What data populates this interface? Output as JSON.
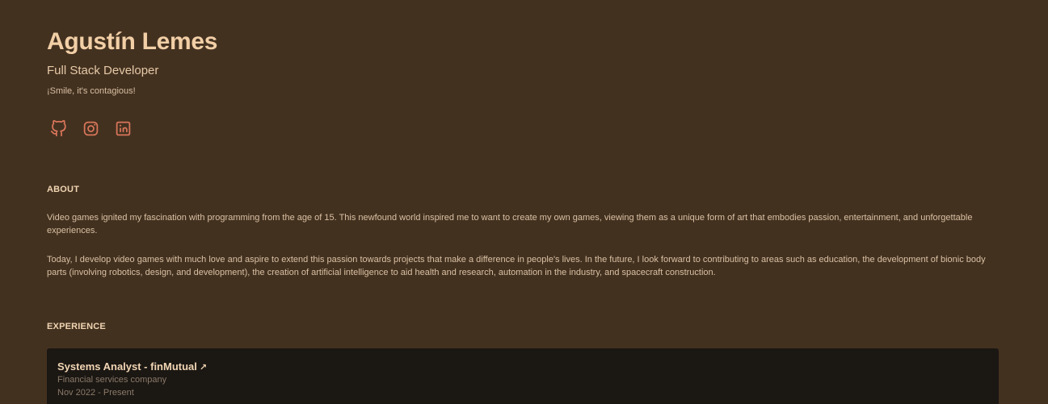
{
  "profile": {
    "name": "Agustín Lemes",
    "role": "Full Stack Developer",
    "tagline": "¡Smile, it's contagious!"
  },
  "socials": [
    {
      "icon": "github-icon"
    },
    {
      "icon": "instagram-icon"
    },
    {
      "icon": "linkedin-icon"
    }
  ],
  "colors": {
    "background": "#433120",
    "accent": "#d9765a",
    "card": "#1b1713"
  },
  "about": {
    "heading": "ABOUT",
    "paragraphs": [
      "Video games ignited my fascination with programming from the age of 15. This newfound world inspired me to want to create my own games, viewing them as a unique form of art that embodies passion, entertainment, and unforgettable experiences.",
      "Today, I develop video games with much love and aspire to extend this passion towards projects that make a difference in people's lives. In the future, I look forward to contributing to areas such as education, the development of bionic body parts (involving robotics, design, and development), the creation of artificial intelligence to aid health and research, automation in the industry, and spacecraft construction."
    ]
  },
  "experience": {
    "heading": "EXPERIENCE",
    "items": [
      {
        "title": "Systems Analyst - finMutual",
        "arrow": "↗",
        "description": "Financial services company",
        "period": "Nov 2022 - Present"
      }
    ]
  }
}
